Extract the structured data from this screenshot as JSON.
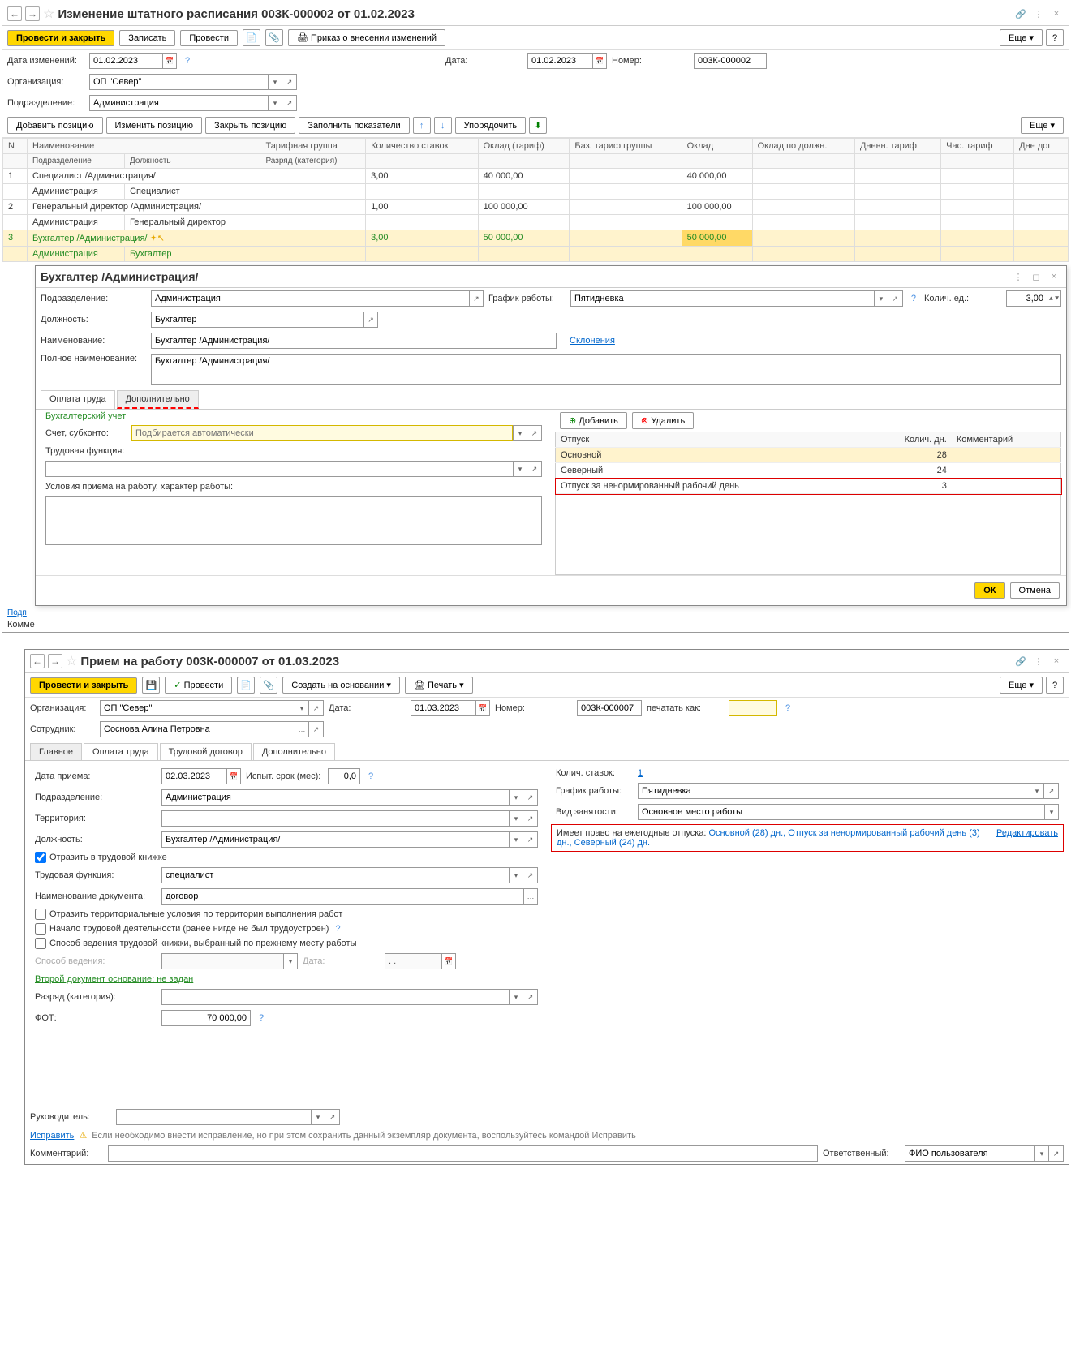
{
  "win1": {
    "title": "Изменение штатного расписания 003К-000002 от 01.02.2023",
    "toolbar": {
      "post_close": "Провести и закрыть",
      "save": "Записать",
      "post": "Провести",
      "order": "Приказ о внесении изменений",
      "more": "Еще"
    },
    "fields": {
      "date_change_label": "Дата изменений:",
      "date_change": "01.02.2023",
      "date_label": "Дата:",
      "date": "01.02.2023",
      "number_label": "Номер:",
      "number": "003К-000002",
      "org_label": "Организация:",
      "org": "ОП \"Север\"",
      "dept_label": "Подразделение:",
      "dept": "Администрация"
    },
    "subtoolbar": {
      "add": "Добавить позицию",
      "edit": "Изменить позицию",
      "close": "Закрыть позицию",
      "fill": "Заполнить показатели",
      "sort": "Упорядочить",
      "more": "Еще"
    },
    "grid": {
      "headers": [
        "N",
        "Наименование",
        "Тарифная группа",
        "Количество ставок",
        "Оклад (тариф)",
        "Баз. тариф группы",
        "Оклад",
        "Оклад по должн.",
        "Дневн. тариф",
        "Час. тариф",
        "Дне дог"
      ],
      "sub_headers": [
        "",
        "Подразделение",
        "Должность",
        "Разряд (категория)",
        "",
        "",
        "",
        "",
        "",
        "",
        ""
      ],
      "rows": [
        {
          "n": "1",
          "name": "Специалист /Администрация/",
          "dept": "Администрация",
          "pos": "Специалист",
          "count": "3,00",
          "salary": "40 000,00",
          "okl": "40 000,00"
        },
        {
          "n": "2",
          "name": "Генеральный директор /Администрация/",
          "dept": "Администрация",
          "pos": "Генеральный директор",
          "count": "1,00",
          "salary": "100 000,00",
          "okl": "100 000,00"
        },
        {
          "n": "3",
          "name": "Бухгалтер /Администрация/",
          "dept": "Администрация",
          "pos": "Бухгалтер",
          "count": "3,00",
          "salary": "50 000,00",
          "okl": "50 000,00"
        }
      ]
    },
    "bottom_links": {
      "podl": "Подп",
      "komm_label": "Комме"
    }
  },
  "pos_dialog": {
    "title": "Бухгалтер /Администрация/",
    "dept_label": "Подразделение:",
    "dept": "Администрация",
    "schedule_label": "График работы:",
    "schedule": "Пятидневка",
    "units_label": "Колич. ед.:",
    "units": "3,00",
    "position_label": "Должность:",
    "position": "Бухгалтер",
    "name_label": "Наименование:",
    "name": "Бухгалтер /Администрация/",
    "declension": "Склонения",
    "full_name_label": "Полное наименование:",
    "full_name": "Бухгалтер /Администрация/",
    "tabs": {
      "pay": "Оплата труда",
      "extra": "Дополнительно"
    },
    "acc_title": "Бухгалтерский учет",
    "account_label": "Счет, субконто:",
    "account_ph": "Подбирается автоматически",
    "work_func_label": "Трудовая функция:",
    "conditions_label": "Условия приема на работу, характер работы:",
    "vac_toolbar": {
      "add": "Добавить",
      "del": "Удалить"
    },
    "vac_headers": [
      "Отпуск",
      "Колич. дн.",
      "Комментарий"
    ],
    "vac_rows": [
      {
        "name": "Основной",
        "days": "28"
      },
      {
        "name": "Северный",
        "days": "24"
      },
      {
        "name": "Отпуск за ненормированный рабочий день",
        "days": "3"
      }
    ],
    "ok": "ОК",
    "cancel": "Отмена"
  },
  "win2": {
    "title": "Прием на работу 003К-000007 от 01.03.2023",
    "toolbar": {
      "post_close": "Провести и закрыть",
      "post": "Провести",
      "create": "Создать на основании",
      "print": "Печать",
      "more": "Еще"
    },
    "org_label": "Организация:",
    "org": "ОП \"Север\"",
    "date_label": "Дата:",
    "date": "01.03.2023",
    "number_label": "Номер:",
    "number": "003К-000007",
    "print_as_label": "печатать как:",
    "print_as": "",
    "emp_label": "Сотрудник:",
    "emp": "Соснова Алина Петровна",
    "tabs": {
      "main": "Главное",
      "pay": "Оплата труда",
      "contract": "Трудовой договор",
      "extra": "Дополнительно"
    },
    "hire_date_label": "Дата приема:",
    "hire_date": "02.03.2023",
    "trial_label": "Испыт. срок (мес):",
    "trial": "0,0",
    "dept_label": "Подразделение:",
    "dept": "Администрация",
    "terr_label": "Территория:",
    "terr": "",
    "pos_label": "Должность:",
    "pos": "Бухгалтер /Администрация/",
    "reflect_label": "Отразить в трудовой книжке",
    "work_func_label": "Трудовая функция:",
    "work_func": "специалист",
    "doc_name_label": "Наименование документа:",
    "doc_name": "договор",
    "terr_cond_label": "Отразить территориальные условия по территории выполнения работ",
    "start_label": "Начало трудовой деятельности (ранее нигде не был трудоустроен)",
    "book_method_label": "Способ ведения трудовой книжки, выбранный по прежнему месту работы",
    "method_label": "Способ ведения:",
    "date2_label": "Дата:",
    "date2": ". .",
    "second_doc": "Второй документ основание: не задан",
    "grade_label": "Разряд (категория):",
    "fot_label": "ФОТ:",
    "fot": "70 000,00",
    "rate_label": "Колич. ставок:",
    "rate": "1",
    "schedule_label": "График работы:",
    "schedule": "Пятидневка",
    "emp_type_label": "Вид занятости:",
    "emp_type": "Основное место работы",
    "vac_right_label": "Имеет право на ежегодные отпуска:",
    "vac_right_val": "Основной (28) дн., Отпуск за ненормированный рабочий день (3) дн., Северный (24) дн.",
    "edit": "Редактировать",
    "head_label": "Руководитель:",
    "fix": "Исправить",
    "fix_hint": "Если необходимо внести исправление, но при этом сохранить данный экземпляр документа, воспользуйтесь командой Исправить",
    "comment_label": "Комментарий:",
    "resp_label": "Ответственный:",
    "resp": "ФИО пользователя"
  }
}
